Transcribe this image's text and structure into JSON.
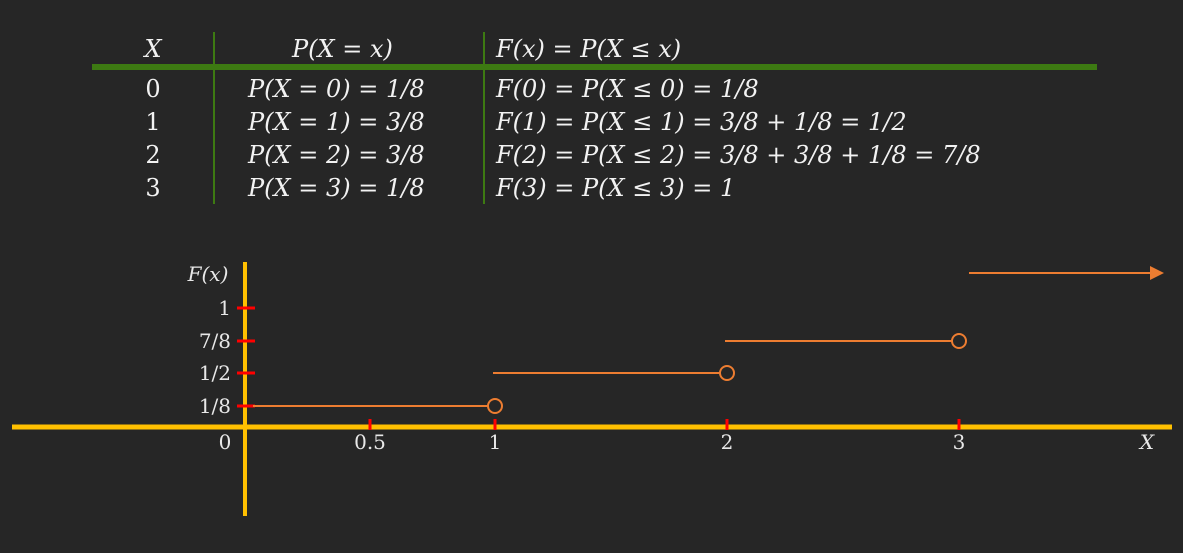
{
  "table": {
    "headers": {
      "x": "X",
      "pmf": "P(X = x)",
      "cdf": "F(x) = P(X ≤ x)"
    },
    "rows": [
      {
        "x": "0",
        "pmf": "P(X = 0) = 1/8",
        "cdf": "F(0) = P(X ≤ 0) = 1/8"
      },
      {
        "x": "1",
        "pmf": "P(X = 1) = 3/8",
        "cdf": "F(1) = P(X ≤ 1) = 3/8 + 1/8 = 1/2"
      },
      {
        "x": "2",
        "pmf": "P(X = 2) = 3/8",
        "cdf": "F(2) = P(X ≤ 2) = 3/8 + 3/8 + 1/8 = 7/8"
      },
      {
        "x": "3",
        "pmf": "P(X = 3) = 1/8",
        "cdf": "F(3) = P(X ≤ 3) = 1"
      }
    ],
    "rule_color": "#3d7a12"
  },
  "chart_data": {
    "type": "line",
    "step": true,
    "xlabel": "X",
    "ylabel": "F(x)",
    "x_ticks": [
      {
        "value": 0,
        "label": "0"
      },
      {
        "value": 0.5,
        "label": "0.5"
      },
      {
        "value": 1,
        "label": "1"
      },
      {
        "value": 2,
        "label": "2"
      },
      {
        "value": 3,
        "label": "3"
      }
    ],
    "y_ticks": [
      {
        "value": 0.125,
        "label": "1/8"
      },
      {
        "value": 0.5,
        "label": "1/2"
      },
      {
        "value": 0.875,
        "label": "7/8"
      },
      {
        "value": 1,
        "label": "1"
      }
    ],
    "segments": [
      {
        "x_start": 0,
        "x_end": 1,
        "y": 0.125,
        "open_end": true
      },
      {
        "x_start": 1,
        "x_end": 2,
        "y": 0.5,
        "open_end": true
      },
      {
        "x_start": 2,
        "x_end": 3,
        "y": 0.875,
        "open_end": true
      },
      {
        "x_start": 3,
        "x_end": null,
        "y": 1,
        "arrow": true
      }
    ],
    "colors": {
      "axis": "#ffc000",
      "tick": "#ff0000",
      "step": "#ed7d31"
    }
  }
}
